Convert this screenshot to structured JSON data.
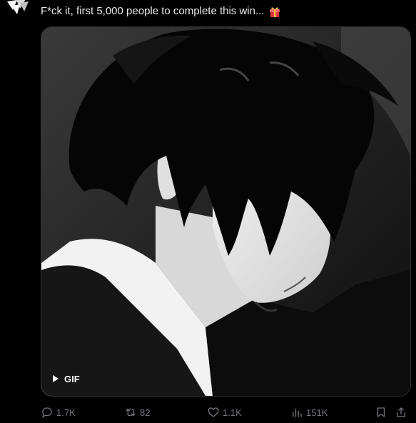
{
  "post": {
    "text": "F*ck it, first 5,000 people to complete this win...",
    "text_emoji_icon": "gift-icon",
    "media": {
      "type_badge": "GIF",
      "description_icon": "anime-character-image"
    },
    "actions": {
      "replies": "1.7K",
      "reposts": "82",
      "likes": "1.1K",
      "views": "151K"
    }
  },
  "colors": {
    "background": "#000000",
    "text": "#e7e9ea",
    "muted": "#71767b",
    "border": "#2f3336",
    "gift_red": "#e0383e",
    "gift_gold": "#f5c04a"
  }
}
